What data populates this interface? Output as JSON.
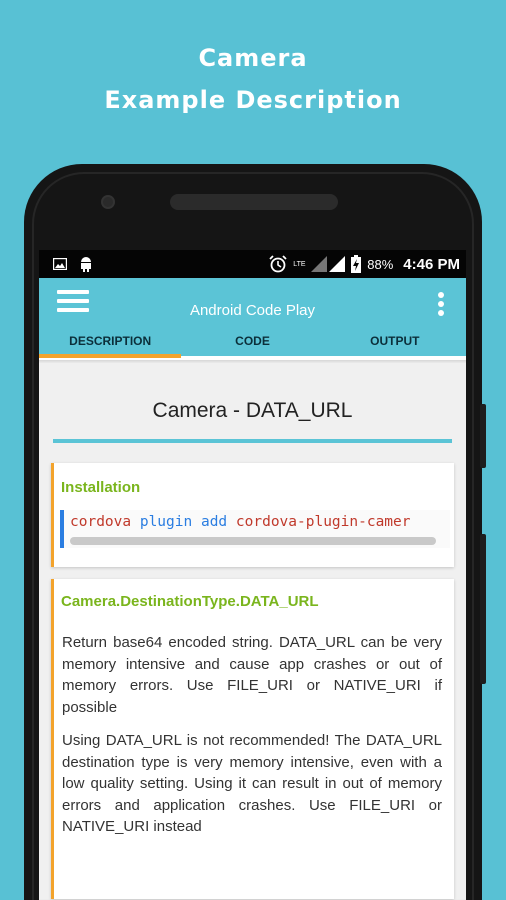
{
  "promo": {
    "line1": "Camera",
    "line2": "Example Description"
  },
  "statusbar": {
    "icons_left": [
      "image-icon",
      "android-icon"
    ],
    "icons_right": [
      "alarm-icon",
      "lte-icon",
      "signal-icon",
      "battery-charging-icon"
    ],
    "lte_label": "LTE",
    "battery": "88%",
    "time": "4:46 PM"
  },
  "appbar": {
    "title": "Android Code Play"
  },
  "tabs": [
    {
      "label": "DESCRIPTION",
      "active": true
    },
    {
      "label": "CODE",
      "active": false
    },
    {
      "label": "OUTPUT",
      "active": false
    }
  ],
  "page": {
    "title": "Camera - DATA_URL"
  },
  "installation": {
    "heading": "Installation",
    "code_parts": [
      "cordova",
      "plugin",
      "add",
      "cordova-plugin-camer"
    ]
  },
  "destination": {
    "heading": "Camera.DestinationType.DATA_URL",
    "paragraph1": "Return base64 encoded string. DATA_URL can be very memory intensive and cause app crashes or out of memory errors. Use FILE_URI or NATIVE_URI if possible",
    "paragraph2": "Using DATA_URL is not recommended! The DATA_URL destination type is very memory intensive, even with a low quality setting. Using it can result in out of memory errors and application crashes. Use FILE_URI or NATIVE_URI instead"
  },
  "colors": {
    "background": "#58c1d4",
    "accent_orange": "#f3a32c",
    "heading_green": "#7ab51d",
    "code_red": "#c0392b",
    "code_blue": "#2a7de1"
  }
}
